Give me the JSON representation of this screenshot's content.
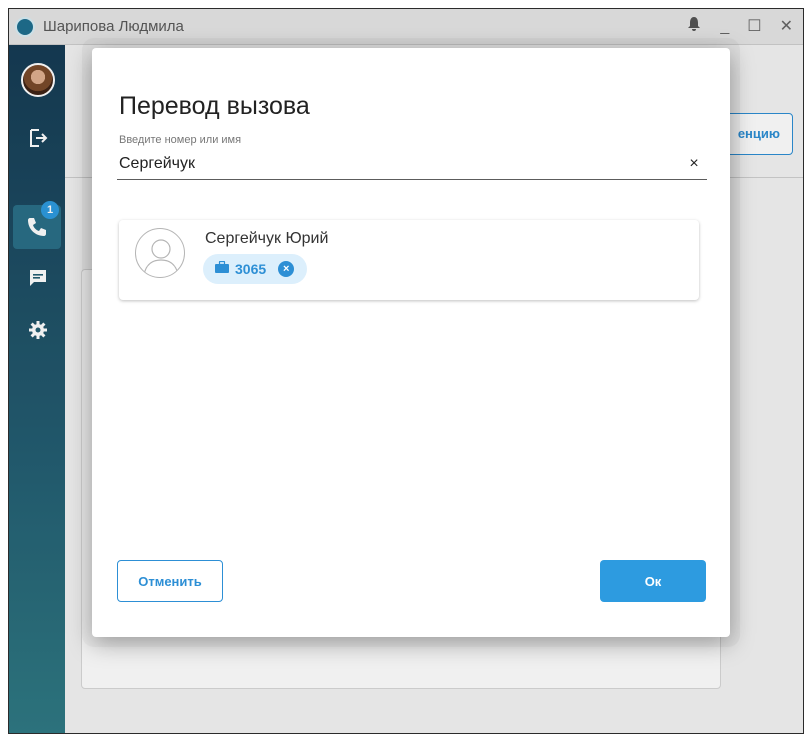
{
  "window": {
    "title": "Шарипова Людмила",
    "controls": {
      "bell": "bell-icon",
      "minimize": "_",
      "maximize": "☐",
      "close": "✕"
    }
  },
  "sidebar": {
    "calls_badge": "1",
    "icons": [
      "logout-icon",
      "phone-icon",
      "chat-icon",
      "gear-icon"
    ]
  },
  "background": {
    "button_label": "енцию"
  },
  "dialog": {
    "title": "Перевод вызова",
    "search": {
      "label": "Введите номер или имя",
      "value": "Сергейчук",
      "clear": "×"
    },
    "result": {
      "name": "Сергейчук Юрий",
      "number": "3065",
      "remove": "×"
    },
    "buttons": {
      "cancel": "Отменить",
      "ok": "Ок"
    }
  },
  "colors": {
    "accent": "#2d9be0",
    "sidebar": "#1f5068"
  }
}
